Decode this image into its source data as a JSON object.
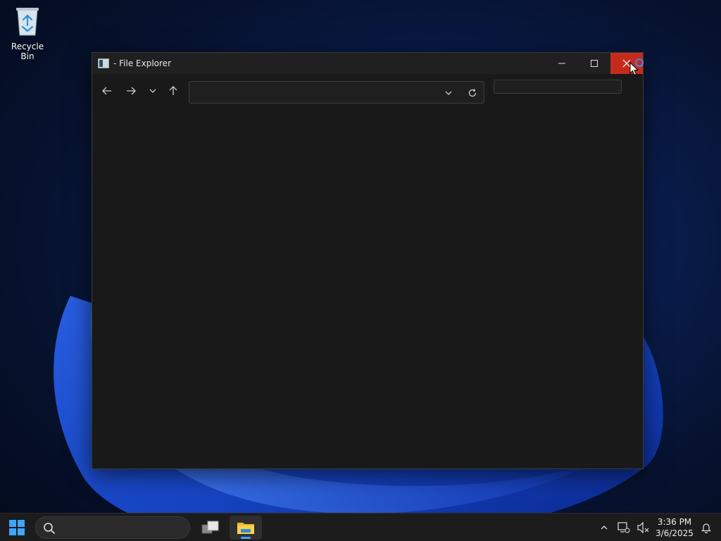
{
  "desktop": {
    "icons": [
      {
        "label": "Recycle Bin",
        "icon": "recycle-bin-icon"
      }
    ]
  },
  "window": {
    "title": "- File Explorer",
    "controls": {
      "minimize": "minimize-icon",
      "maximize": "maximize-icon",
      "close": "close-icon"
    },
    "toolbar": {
      "back": "arrow-left-icon",
      "forward": "arrow-right-icon",
      "recent": "chevron-down-icon",
      "up": "arrow-up-icon",
      "address_value": "",
      "search_value": ""
    }
  },
  "taskbar": {
    "search_value": "",
    "time": "3:36 PM",
    "date": "3/6/2025"
  },
  "colors": {
    "close_button": "#c42b1c",
    "window_bg": "#191919",
    "titlebar_bg": "#202020",
    "taskbar_bg": "#1c1c1c",
    "accent": "#4aa3ff"
  }
}
